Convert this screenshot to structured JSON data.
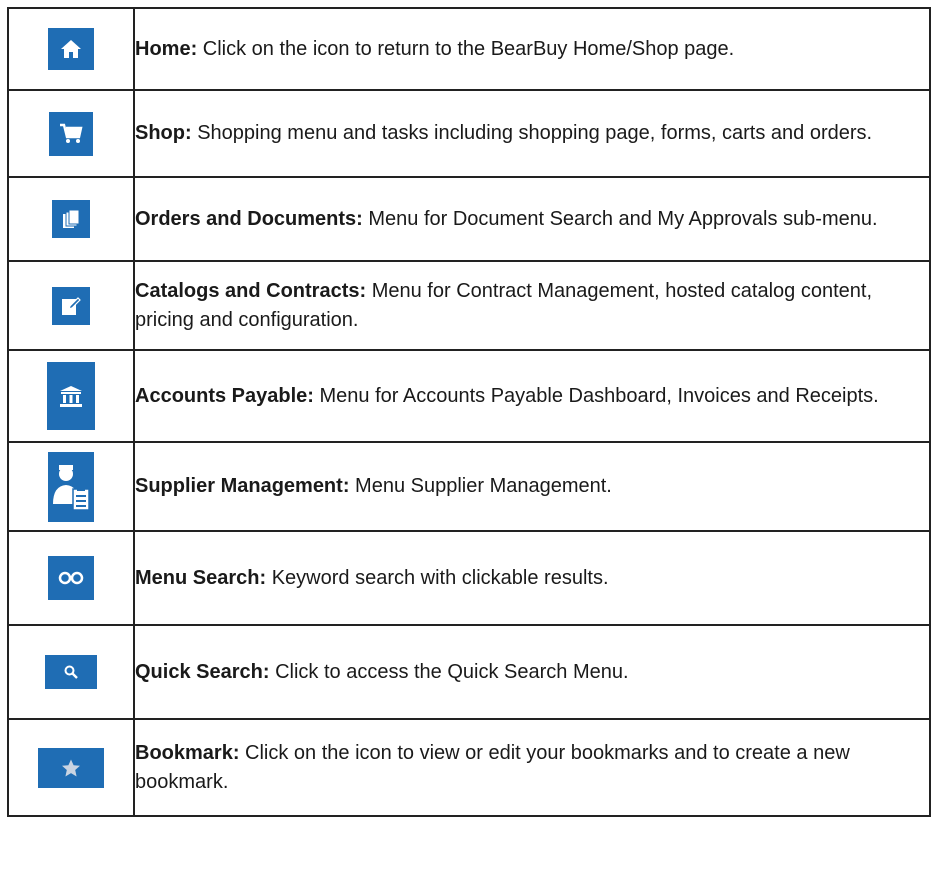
{
  "rows": [
    {
      "term": "Home:",
      "desc": " Click on the icon to return to the BearBuy Home/Shop page.",
      "icon": "home-icon"
    },
    {
      "term": "Shop:",
      "desc": " Shopping menu and tasks including shopping page, forms, carts and orders.",
      "icon": "cart-icon"
    },
    {
      "term": "Orders and Documents:",
      "desc": " Menu for Document Search and My Approvals sub-menu.",
      "icon": "documents-icon"
    },
    {
      "term": "Catalogs and Contracts:",
      "desc": " Menu for Contract Management, hosted catalog content, pricing and configuration.",
      "icon": "edit-document-icon"
    },
    {
      "term": "Accounts Payable:",
      "desc": " Menu for Accounts Payable Dashboard, Invoices and Receipts.",
      "icon": "bank-icon"
    },
    {
      "term": "Supplier Management:",
      "desc": " Menu Supplier Management.",
      "icon": "supplier-icon"
    },
    {
      "term": "Menu Search:",
      "desc": " Keyword search with clickable results.",
      "icon": "binoculars-icon"
    },
    {
      "term": "Quick Search:",
      "desc": " Click to access the Quick Search Menu.",
      "icon": "search-icon"
    },
    {
      "term": "Bookmark:",
      "desc": " Click on the icon to view or edit your bookmarks and to create a new bookmark.",
      "icon": "star-icon"
    }
  ],
  "colors": {
    "icon_bg": "#1f6db4",
    "icon_fg": "#ffffff",
    "border": "#222222"
  }
}
